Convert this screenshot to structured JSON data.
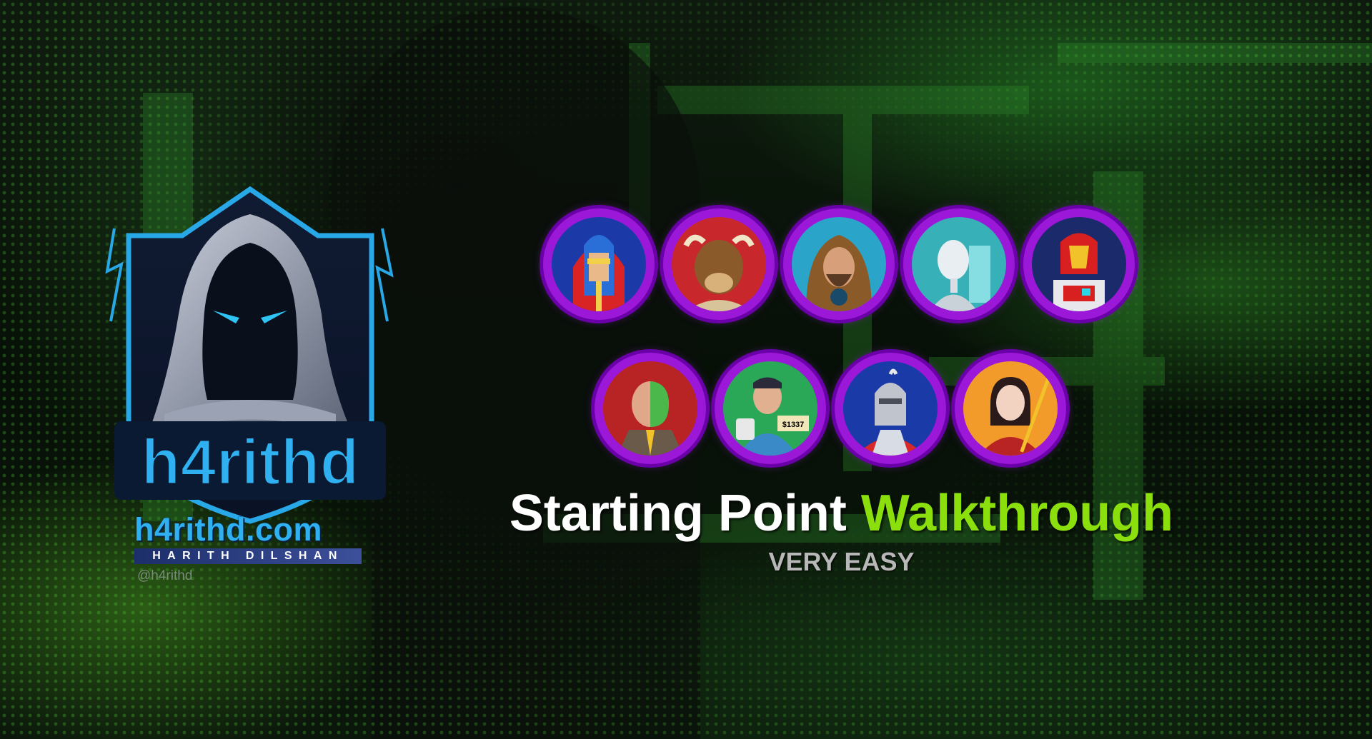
{
  "brand": {
    "logo_text": "h4rithd",
    "site": "h4rithd.com",
    "name": "HARITH DILSHAN",
    "handle": "@h4rithd",
    "colors": {
      "primary": "#2fb0f0",
      "dark": "#0b1a33"
    }
  },
  "badges": {
    "border_color": "#9c18d8",
    "row1": [
      "helmeted-warrior",
      "bull-warrior",
      "hooded-mystic",
      "android-woman",
      "red-gold-armored-robot"
    ],
    "row2": [
      "two-face-businessman",
      "man-with-1337-sign",
      "armored-knight",
      "woman-with-staff"
    ],
    "price_tag": "$1337"
  },
  "headline": {
    "part1": "Starting Point",
    "part2": "Walkthrough",
    "accent_color": "#8adf0c"
  },
  "difficulty": "VERY EASY"
}
